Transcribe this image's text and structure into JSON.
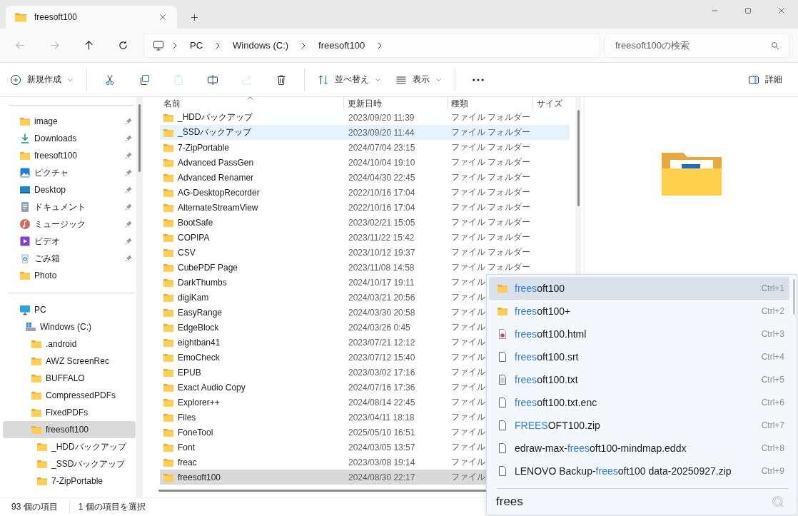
{
  "window": {
    "tab_title": "freesoft100"
  },
  "navigation": [
    {
      "kind": "back",
      "disabled": true
    },
    {
      "kind": "forward",
      "disabled": true
    },
    {
      "kind": "up",
      "disabled": false
    },
    {
      "kind": "refresh",
      "disabled": false
    }
  ],
  "address": {
    "crumbs": [
      "PC",
      "Windows (C:)",
      "freesoft100"
    ]
  },
  "search": {
    "placeholder": "freesoft100の検索"
  },
  "commands": [
    {
      "kind": "new",
      "label": "新規作成",
      "dropdown": true,
      "disabled": false
    },
    {
      "kind": "separator"
    },
    {
      "kind": "cut",
      "disabled": false
    },
    {
      "kind": "copy",
      "disabled": false
    },
    {
      "kind": "paste",
      "disabled": true
    },
    {
      "kind": "rename",
      "disabled": false
    },
    {
      "kind": "share",
      "disabled": true
    },
    {
      "kind": "delete",
      "disabled": false
    },
    {
      "kind": "separator"
    },
    {
      "kind": "sort",
      "label": "並べ替え",
      "dropdown": true,
      "disabled": false
    },
    {
      "kind": "view",
      "label": "表示",
      "dropdown": true,
      "disabled": false
    },
    {
      "kind": "separator"
    },
    {
      "kind": "more",
      "disabled": false
    }
  ],
  "details_button": {
    "label": "詳細"
  },
  "sidebar": {
    "quick_access": [
      {
        "kind": "folder",
        "label": "image",
        "pinned": true
      },
      {
        "kind": "download",
        "label": "Downloads",
        "pinned": true
      },
      {
        "kind": "folder",
        "label": "freesoft100",
        "pinned": true
      },
      {
        "kind": "pictures",
        "label": "ピクチャ",
        "pinned": true
      },
      {
        "kind": "desktop",
        "label": "Desktop",
        "pinned": true
      },
      {
        "kind": "documents",
        "label": "ドキュメント",
        "pinned": true
      },
      {
        "kind": "music",
        "label": "ミュージック",
        "pinned": true
      },
      {
        "kind": "videos",
        "label": "ビデオ",
        "pinned": true
      },
      {
        "kind": "recycle",
        "label": "ごみ箱",
        "pinned": true
      },
      {
        "kind": "folder",
        "label": "Photo",
        "pinned": false
      }
    ],
    "tree": [
      {
        "kind": "pc",
        "label": "PC",
        "selected": false,
        "children": [
          {
            "kind": "drive",
            "label": "Windows (C:)",
            "selected": false,
            "children": [
              {
                "kind": "folder",
                "label": ".android",
                "selected": false
              },
              {
                "kind": "folder",
                "label": "AWZ ScreenRec",
                "selected": false
              },
              {
                "kind": "folder",
                "label": "BUFFALO",
                "selected": false
              },
              {
                "kind": "folder",
                "label": "CompressedPDFs",
                "selected": false
              },
              {
                "kind": "folder",
                "label": "FixedPDFs",
                "selected": false
              },
              {
                "kind": "folder",
                "label": "freesoft100",
                "selected": true,
                "children": [
                  {
                    "kind": "folder",
                    "label": "_HDDバックアップ",
                    "selected": false
                  },
                  {
                    "kind": "folder",
                    "label": "_SSDバックアップ",
                    "selected": false
                  },
                  {
                    "kind": "folder",
                    "label": "7-ZipPortable",
                    "selected": false
                  }
                ]
              }
            ]
          }
        ]
      }
    ]
  },
  "file_list": {
    "columns": [
      {
        "label": "名前",
        "sorted": true
      },
      {
        "label": "更新日時",
        "sorted": false
      },
      {
        "label": "種類",
        "sorted": false
      },
      {
        "label": "サイズ",
        "sorted": false
      }
    ],
    "rows": [
      {
        "name": "_HDDバックアップ",
        "modified": "2023/09/20 11:39",
        "type": "ファイル フォルダー",
        "selected": false,
        "hovered": false
      },
      {
        "name": "_SSDバックアップ",
        "modified": "2023/09/20 11:44",
        "type": "ファイル フォルダー",
        "selected": false,
        "hovered": true
      },
      {
        "name": "7-ZipPortable",
        "modified": "2024/07/04 23:15",
        "type": "ファイル フォルダー",
        "selected": false,
        "hovered": false
      },
      {
        "name": "Advanced PassGen",
        "modified": "2024/10/04 19:10",
        "type": "ファイル フォルダー",
        "selected": false,
        "hovered": false
      },
      {
        "name": "Advanced Renamer",
        "modified": "2024/04/30 22:45",
        "type": "ファイル フォルダー",
        "selected": false,
        "hovered": false
      },
      {
        "name": "AG-DesktopRecorder",
        "modified": "2022/10/16 17:04",
        "type": "ファイル フォルダー",
        "selected": false,
        "hovered": false
      },
      {
        "name": "AlternateStreamView",
        "modified": "2022/10/16 17:04",
        "type": "ファイル フォルダー",
        "selected": false,
        "hovered": false
      },
      {
        "name": "BootSafe",
        "modified": "2023/02/21 15:05",
        "type": "ファイル フォルダー",
        "selected": false,
        "hovered": false
      },
      {
        "name": "COPIPA",
        "modified": "2023/11/22 15:42",
        "type": "ファイル フォルダー",
        "selected": false,
        "hovered": false
      },
      {
        "name": "CSV",
        "modified": "2023/10/12 19:37",
        "type": "ファイル フォルダー",
        "selected": false,
        "hovered": false
      },
      {
        "name": "CubePDF Page",
        "modified": "2023/11/08 14:58",
        "type": "ファイル フォルダー",
        "selected": false,
        "hovered": false
      },
      {
        "name": "DarkThumbs",
        "modified": "2024/10/17 19:11",
        "type": "ファイル",
        "selected": false,
        "hovered": false
      },
      {
        "name": "digiKam",
        "modified": "2024/03/21 20:56",
        "type": "ファイル",
        "selected": false,
        "hovered": false
      },
      {
        "name": "EasyRange",
        "modified": "2024/03/30 20:58",
        "type": "ファイル",
        "selected": false,
        "hovered": false
      },
      {
        "name": "EdgeBlock",
        "modified": "2024/03/26 0:45",
        "type": "ファイル",
        "selected": false,
        "hovered": false
      },
      {
        "name": "eightban41",
        "modified": "2023/07/21 12:12",
        "type": "ファイル",
        "selected": false,
        "hovered": false
      },
      {
        "name": "EmoCheck",
        "modified": "2023/07/12 15:40",
        "type": "ファイル",
        "selected": false,
        "hovered": false
      },
      {
        "name": "EPUB",
        "modified": "2023/03/02 17:16",
        "type": "ファイル",
        "selected": false,
        "hovered": false
      },
      {
        "name": "Exact Audio Copy",
        "modified": "2024/07/16 17:36",
        "type": "ファイル",
        "selected": false,
        "hovered": false
      },
      {
        "name": "Explorer++",
        "modified": "2024/08/14 22:45",
        "type": "ファイル",
        "selected": false,
        "hovered": false
      },
      {
        "name": "Files",
        "modified": "2023/04/11 18:18",
        "type": "ファイル",
        "selected": false,
        "hovered": false
      },
      {
        "name": "FoneTool",
        "modified": "2025/05/10 16:51",
        "type": "ファイル",
        "selected": false,
        "hovered": false
      },
      {
        "name": "Font",
        "modified": "2024/03/05 13:57",
        "type": "ファイル",
        "selected": false,
        "hovered": false
      },
      {
        "name": "freac",
        "modified": "2023/03/08 19:14",
        "type": "ファイル",
        "selected": false,
        "hovered": false
      },
      {
        "name": "freesoft100",
        "modified": "2024/08/30 22:17",
        "type": "ファイル",
        "selected": true,
        "hovered": false
      }
    ]
  },
  "status_bar": [
    "93 個の項目",
    "1 個の項目を選択"
  ],
  "quick_search": {
    "items": [
      {
        "kind": "folder",
        "parts": [
          {
            "text": "frees",
            "match": true
          },
          {
            "text": "oft100",
            "match": false
          }
        ],
        "shortcut": "Ctrl+1",
        "selected": true
      },
      {
        "kind": "folder",
        "parts": [
          {
            "text": "frees",
            "match": true
          },
          {
            "text": "oft100+",
            "match": false
          }
        ],
        "shortcut": "Ctrl+2",
        "selected": false
      },
      {
        "kind": "html",
        "parts": [
          {
            "text": "frees",
            "match": true
          },
          {
            "text": "oft100.html",
            "match": false
          }
        ],
        "shortcut": "Ctrl+3",
        "selected": false
      },
      {
        "kind": "file",
        "parts": [
          {
            "text": "frees",
            "match": true
          },
          {
            "text": "oft100.srt",
            "match": false
          }
        ],
        "shortcut": "Ctrl+4",
        "selected": false
      },
      {
        "kind": "text",
        "parts": [
          {
            "text": "frees",
            "match": true
          },
          {
            "text": "oft100.txt",
            "match": false
          }
        ],
        "shortcut": "Ctrl+5",
        "selected": false
      },
      {
        "kind": "file",
        "parts": [
          {
            "text": "frees",
            "match": true
          },
          {
            "text": "oft100.txt.enc",
            "match": false
          }
        ],
        "shortcut": "Ctrl+6",
        "selected": false
      },
      {
        "kind": "file",
        "parts": [
          {
            "text": "FREES",
            "match": true
          },
          {
            "text": "OFT100.zip",
            "match": false
          }
        ],
        "shortcut": "Ctrl+7",
        "selected": false
      },
      {
        "kind": "file",
        "parts": [
          {
            "text": "edraw-max-",
            "match": false
          },
          {
            "text": "frees",
            "match": true
          },
          {
            "text": "oft100-mindmap.eddx",
            "match": false
          }
        ],
        "shortcut": "Ctrl+8",
        "selected": false
      },
      {
        "kind": "file",
        "parts": [
          {
            "text": "LENOVO Backup-",
            "match": false
          },
          {
            "text": "frees",
            "match": true
          },
          {
            "text": "oft100 data-20250927.zip",
            "match": false
          }
        ],
        "shortcut": "Ctrl+9",
        "selected": false
      }
    ],
    "query": "frees"
  }
}
